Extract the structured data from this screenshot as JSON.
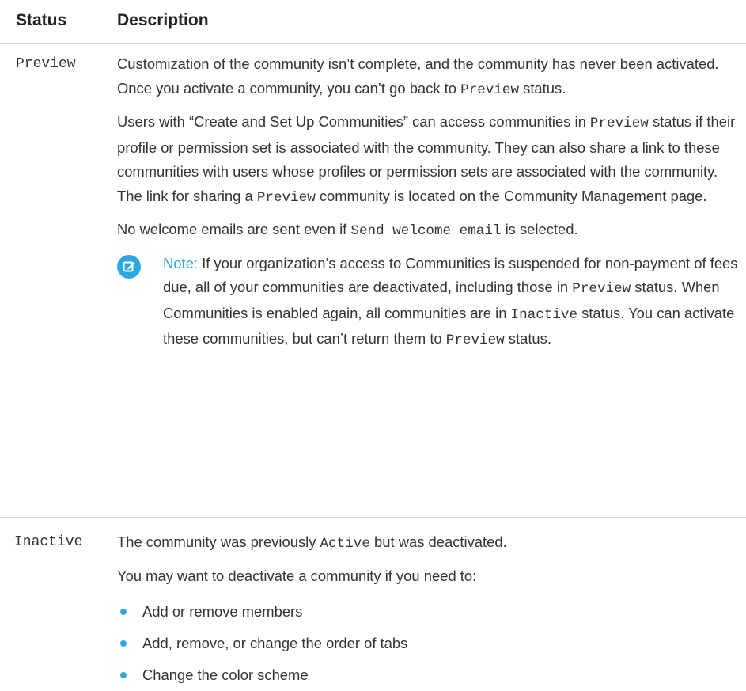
{
  "header": {
    "status": "Status",
    "description": "Description"
  },
  "preview": {
    "status": "Preview",
    "p1": {
      "a": "Customization of the community isn’t complete, and the community has never been activated. Once you activate a community, you can’t go back to ",
      "code": "Preview",
      "b": " status."
    },
    "p2": {
      "a": "Users with “Create and Set Up Communities” can access communities in ",
      "code1": "Preview",
      "b": " status if their profile or permission set is associated with the community. They can also share a link to these communities with users whose profiles or permission sets are associated with the community. The link for sharing a ",
      "code2": "Preview",
      "c": " community is located on the Community Management page."
    },
    "p3": {
      "a": "No welcome emails are sent even if ",
      "code": "Send welcome email",
      "b": " is selected."
    },
    "note": {
      "icon": "note-edit-icon",
      "label": "Note:",
      "a": " If your organization’s access to Communities is suspended for non-payment of fees due, all of your communities are deactivated, including those in ",
      "code1": "Preview",
      "b": " status. When Communities is enabled again, all communities are in ",
      "code2": "Inactive",
      "c": " status. You can activate these communities, but can’t return them to ",
      "code3": "Preview",
      "d": " status."
    }
  },
  "inactive": {
    "status": "Inactive",
    "p1": {
      "a": "The community was previously ",
      "code": "Active",
      "b": " but was deactivated."
    },
    "p2": "You may want to deactivate a community if you need to:",
    "bullets": [
      "Add or remove members",
      "Add, remove, or change the order of tabs",
      "Change the color scheme"
    ]
  },
  "colors": {
    "accent": "#2ea8df",
    "text": "#333333",
    "divider": "#d8d8d8"
  }
}
